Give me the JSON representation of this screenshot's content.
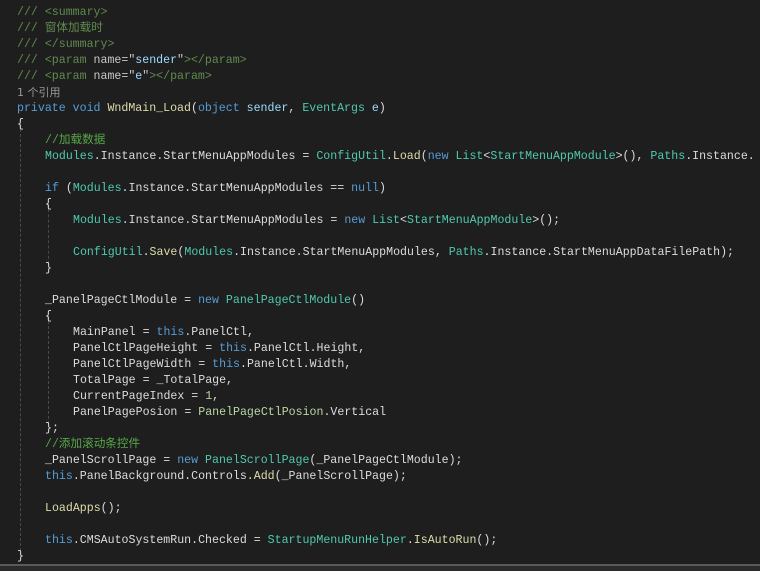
{
  "colors": {
    "background": "#1e1e1e",
    "comment": "#57a64a",
    "keyword": "#569cd6",
    "type": "#4ec9b0",
    "method": "#dcdcaa",
    "plain": "#dcdcdc"
  },
  "code_lines": [
    {
      "indent": 0,
      "tokens": [
        [
          "d",
          "/// <summary>"
        ]
      ]
    },
    {
      "indent": 0,
      "tokens": [
        [
          "d",
          "/// 窗体加载时"
        ]
      ]
    },
    {
      "indent": 0,
      "tokens": [
        [
          "d",
          "/// </summary>"
        ]
      ]
    },
    {
      "indent": 0,
      "tokens": [
        [
          "d",
          "/// <param "
        ],
        [
          "a",
          "name=\""
        ],
        [
          "s",
          "sender"
        ],
        [
          "a",
          "\""
        ],
        [
          "d",
          "></param>"
        ]
      ]
    },
    {
      "indent": 0,
      "tokens": [
        [
          "d",
          "/// <param "
        ],
        [
          "a",
          "name=\""
        ],
        [
          "s",
          "e"
        ],
        [
          "a",
          "\""
        ],
        [
          "d",
          "></param>"
        ]
      ]
    },
    {
      "indent": 0,
      "ref": true,
      "tokens": [
        [
          "r",
          "1 个引用"
        ]
      ]
    },
    {
      "indent": 0,
      "tokens": [
        [
          "k",
          "private "
        ],
        [
          "k",
          "void "
        ],
        [
          "m",
          "WndMain_Load"
        ],
        [
          "p",
          "("
        ],
        [
          "k",
          "object "
        ],
        [
          "v",
          "sender"
        ],
        [
          "p",
          ", "
        ],
        [
          "t",
          "EventArgs "
        ],
        [
          "v",
          "e"
        ],
        [
          "p",
          ")"
        ]
      ]
    },
    {
      "indent": 0,
      "tokens": [
        [
          "p",
          "{"
        ]
      ]
    },
    {
      "indent": 1,
      "tokens": [
        [
          "c",
          "//加载数据"
        ]
      ]
    },
    {
      "indent": 1,
      "tokens": [
        [
          "t",
          "Modules"
        ],
        [
          "p",
          ".Instance.StartMenuAppModules = "
        ],
        [
          "t",
          "ConfigUtil"
        ],
        [
          "p",
          "."
        ],
        [
          "m",
          "Load"
        ],
        [
          "p",
          "("
        ],
        [
          "k",
          "new "
        ],
        [
          "t",
          "List"
        ],
        [
          "p",
          "<"
        ],
        [
          "t",
          "StartMenuAppModule"
        ],
        [
          "p",
          ">(), "
        ],
        [
          "t",
          "Paths"
        ],
        [
          "p",
          ".Instance."
        ]
      ]
    },
    {
      "indent": 0,
      "tokens": []
    },
    {
      "indent": 1,
      "tokens": [
        [
          "k",
          "if "
        ],
        [
          "p",
          "("
        ],
        [
          "t",
          "Modules"
        ],
        [
          "p",
          ".Instance.StartMenuAppModules == "
        ],
        [
          "k",
          "null"
        ],
        [
          "p",
          ")"
        ]
      ]
    },
    {
      "indent": 1,
      "tokens": [
        [
          "p",
          "{"
        ]
      ]
    },
    {
      "indent": 2,
      "tokens": [
        [
          "t",
          "Modules"
        ],
        [
          "p",
          ".Instance.StartMenuAppModules = "
        ],
        [
          "k",
          "new "
        ],
        [
          "t",
          "List"
        ],
        [
          "p",
          "<"
        ],
        [
          "t",
          "StartMenuAppModule"
        ],
        [
          "p",
          ">();"
        ]
      ]
    },
    {
      "indent": 0,
      "tokens": []
    },
    {
      "indent": 2,
      "tokens": [
        [
          "t",
          "ConfigUtil"
        ],
        [
          "p",
          "."
        ],
        [
          "m",
          "Save"
        ],
        [
          "p",
          "("
        ],
        [
          "t",
          "Modules"
        ],
        [
          "p",
          ".Instance.StartMenuAppModules, "
        ],
        [
          "t",
          "Paths"
        ],
        [
          "p",
          ".Instance.StartMenuAppDataFilePath);"
        ]
      ]
    },
    {
      "indent": 1,
      "tokens": [
        [
          "p",
          "}"
        ]
      ]
    },
    {
      "indent": 0,
      "tokens": []
    },
    {
      "indent": 1,
      "tokens": [
        [
          "p",
          "_PanelPageCtlModule = "
        ],
        [
          "k",
          "new "
        ],
        [
          "t",
          "PanelPageCtlModule"
        ],
        [
          "p",
          "()"
        ]
      ]
    },
    {
      "indent": 1,
      "tokens": [
        [
          "p",
          "{"
        ]
      ]
    },
    {
      "indent": 2,
      "tokens": [
        [
          "p",
          "MainPanel = "
        ],
        [
          "k",
          "this"
        ],
        [
          "p",
          ".PanelCtl,"
        ]
      ]
    },
    {
      "indent": 2,
      "tokens": [
        [
          "p",
          "PanelCtlPageHeight = "
        ],
        [
          "k",
          "this"
        ],
        [
          "p",
          ".PanelCtl.Height,"
        ]
      ]
    },
    {
      "indent": 2,
      "tokens": [
        [
          "p",
          "PanelCtlPageWidth = "
        ],
        [
          "k",
          "this"
        ],
        [
          "p",
          ".PanelCtl.Width,"
        ]
      ]
    },
    {
      "indent": 2,
      "tokens": [
        [
          "p",
          "TotalPage = _TotalPage,"
        ]
      ]
    },
    {
      "indent": 2,
      "tokens": [
        [
          "p",
          "CurrentPageIndex = "
        ],
        [
          "n",
          "1"
        ],
        [
          "p",
          ","
        ]
      ]
    },
    {
      "indent": 2,
      "tokens": [
        [
          "p",
          "PanelPagePosion = "
        ],
        [
          "e",
          "PanelPageCtlPosion"
        ],
        [
          "p",
          ".Vertical"
        ]
      ]
    },
    {
      "indent": 1,
      "tokens": [
        [
          "p",
          "};"
        ]
      ]
    },
    {
      "indent": 1,
      "tokens": [
        [
          "c",
          "//添加滚动条控件"
        ]
      ]
    },
    {
      "indent": 1,
      "tokens": [
        [
          "p",
          "_PanelScrollPage = "
        ],
        [
          "k",
          "new "
        ],
        [
          "t",
          "PanelScrollPage"
        ],
        [
          "p",
          "(_PanelPageCtlModule);"
        ]
      ]
    },
    {
      "indent": 1,
      "tokens": [
        [
          "k",
          "this"
        ],
        [
          "p",
          ".PanelBackground.Controls."
        ],
        [
          "m",
          "Add"
        ],
        [
          "p",
          "(_PanelScrollPage);"
        ]
      ]
    },
    {
      "indent": 0,
      "tokens": []
    },
    {
      "indent": 1,
      "tokens": [
        [
          "m",
          "LoadApps"
        ],
        [
          "p",
          "();"
        ]
      ]
    },
    {
      "indent": 0,
      "tokens": []
    },
    {
      "indent": 1,
      "tokens": [
        [
          "k",
          "this"
        ],
        [
          "p",
          ".CMSAutoSystemRun.Checked = "
        ],
        [
          "t",
          "StartupMenuRunHelper"
        ],
        [
          "p",
          "."
        ],
        [
          "m",
          "IsAutoRun"
        ],
        [
          "p",
          "();"
        ]
      ]
    },
    {
      "indent": 0,
      "tokens": [
        [
          "p",
          "}"
        ]
      ]
    }
  ]
}
